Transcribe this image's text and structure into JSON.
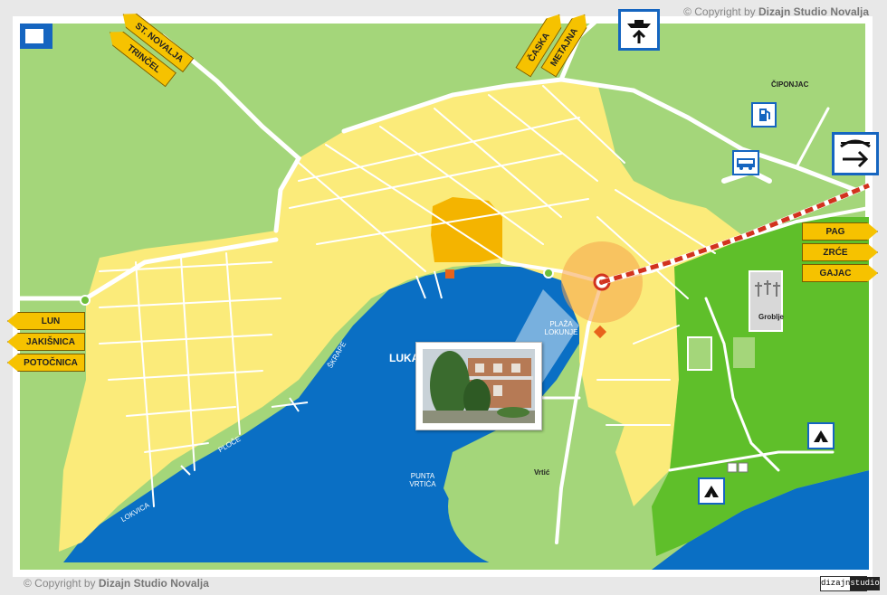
{
  "copyright_top": {
    "prefix": "© Copyright by",
    "brand": "Dizajn Studio Novalja"
  },
  "copyright_bottom": {
    "prefix": "© Copyright by",
    "brand": "Dizajn Studio Novalja"
  },
  "studio_logo": {
    "left": "dizajn",
    "right": "studio"
  },
  "signs_left": [
    "LUN",
    "JAKIŠNICA",
    "POTOČNICA"
  ],
  "signs_right": [
    "PAG",
    "ZRĆE",
    "GAJAC"
  ],
  "signs_top_left": [
    "ST. NOVALJA",
    "TRINČEL"
  ],
  "signs_top_center": [
    "ČASKA",
    "METAJNA"
  ],
  "places": {
    "ciponjac": "ČIPONJAC",
    "groblje": "Groblje",
    "vrtic": "Vrtić",
    "luka": "LUKA",
    "plaza": "PLAŽA\nLOKUNJE",
    "punta": "PUNTA\nVRTIĆA",
    "skrape": "ŠKRAPE",
    "ploce": "PLOČE",
    "lokvica": "LOKVICA"
  },
  "icons": [
    "ferry-icon",
    "fuel-icon",
    "bus-icon",
    "bridge-direction-icon",
    "camping-icon",
    "cemetery-icon",
    "location-marker-icon"
  ],
  "colors": {
    "sea": "#0a6fc4",
    "land": "#a4d67a",
    "town": "#fbeb7a",
    "center": "#f4b400",
    "park": "#5fbf2a",
    "road": "#ffffff",
    "sign": "#f6c200",
    "frame": "#1565c0"
  }
}
